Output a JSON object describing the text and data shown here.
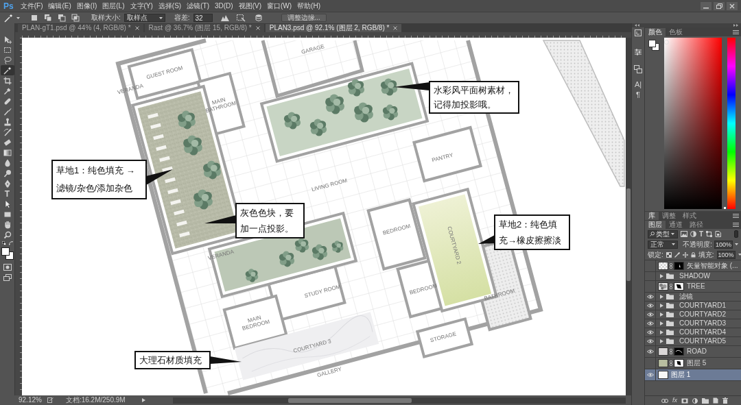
{
  "app": {
    "logo": "Ps"
  },
  "menu": [
    "文件(F)",
    "编辑(E)",
    "图像(I)",
    "图层(L)",
    "文字(Y)",
    "选择(S)",
    "滤镜(T)",
    "3D(D)",
    "视图(V)",
    "窗口(W)",
    "帮助(H)"
  ],
  "options_bar": {
    "sample_size_label": "取样大小:",
    "sample_size": "取样点",
    "tolerance_label": "容差:",
    "tolerance": "32",
    "refine_edge": "调整边缘..."
  },
  "tabs": [
    {
      "label": "PLAN-gT1.psd @ 44% (4, RGB/8) *",
      "selected": false
    },
    {
      "label": "Rast @ 36.7% (图层 15, RGB/8) *",
      "selected": false
    },
    {
      "label": "PLAN3.psd @ 92.1% (图层 2, RGB/8) *",
      "selected": true
    }
  ],
  "tools": [
    {
      "kind": "move",
      "selected": false
    },
    {
      "kind": "marquee",
      "selected": false
    },
    {
      "kind": "lasso",
      "selected": false
    },
    {
      "kind": "magic-wand",
      "selected": true
    },
    {
      "kind": "crop",
      "selected": false
    },
    {
      "kind": "eyedropper",
      "selected": false
    },
    {
      "kind": "healing",
      "selected": false
    },
    {
      "kind": "brush",
      "selected": false
    },
    {
      "kind": "stamp",
      "selected": false
    },
    {
      "kind": "history-brush",
      "selected": false
    },
    {
      "kind": "eraser",
      "selected": false
    },
    {
      "kind": "gradient",
      "selected": false
    },
    {
      "kind": "blur",
      "selected": false
    },
    {
      "kind": "dodge",
      "selected": false
    },
    {
      "kind": "pen",
      "selected": false
    },
    {
      "kind": "type",
      "glyph": "T",
      "selected": false
    },
    {
      "kind": "path-select",
      "selected": false
    },
    {
      "kind": "shape",
      "selected": false
    },
    {
      "kind": "hand",
      "selected": false
    },
    {
      "kind": "zoom",
      "selected": false
    }
  ],
  "canvas": {
    "room_labels": [
      "GARAGE",
      "GUEST ROOM",
      "VERANDA",
      "MAIN BATHROOM",
      "PANTRY",
      "LIVING ROOM",
      "BEDROOM",
      "COURTYARD 2",
      "VERANDA",
      "BEDROOM",
      "STUDY ROOM",
      "BATHROOM",
      "MAIN BEDROOM",
      "COURTYARD 3",
      "STORAGE",
      "GALLERY"
    ],
    "callouts": [
      {
        "lines": [
          "水彩风平面树素材，",
          "记得加投影哦。"
        ]
      },
      {
        "lines": [
          "草地1：纯色填充 →",
          "滤镜/杂色/添加杂色"
        ]
      },
      {
        "lines": [
          "灰色色块，要",
          "加一点投影。"
        ]
      },
      {
        "lines": [
          "草地2：纯色填",
          "充→橡皮擦擦淡"
        ]
      },
      {
        "lines": [
          "大理石材质填充"
        ]
      }
    ]
  },
  "status_bar": {
    "zoom": "92.12%",
    "document": "文档:16.2M/250.9M"
  },
  "dock_icons": [
    {
      "kind": "history"
    },
    {
      "kind": "properties"
    },
    {
      "kind": "comps"
    },
    {
      "kind": "character",
      "glyph": "A|"
    },
    {
      "kind": "paragraph",
      "glyph": "¶"
    }
  ],
  "color_panel": {
    "tabs": [
      {
        "label": "颜色",
        "selected": true
      },
      {
        "label": "色板",
        "selected": false
      }
    ],
    "hue_slider": {
      "level": 0
    }
  },
  "library_panel": {
    "tabs": [
      {
        "label": "库",
        "selected": true
      },
      {
        "label": "调整",
        "selected": false
      },
      {
        "label": "样式",
        "selected": false
      }
    ]
  },
  "layers_panel": {
    "tabs": [
      {
        "label": "图层",
        "selected": true
      },
      {
        "label": "通道",
        "selected": false
      },
      {
        "label": "路径",
        "selected": false
      }
    ],
    "filter": "类型",
    "text_filter_glyph": "T",
    "blend_mode": "正常",
    "opacity_label": "不透明度:",
    "opacity": "100%",
    "lock_label": "锁定:",
    "fill_label": "填充:",
    "fill": "100%",
    "layers": [
      {
        "kind": "layer",
        "name": "矢量智能对象 (...",
        "visible": false,
        "selected": false,
        "mask": true
      },
      {
        "kind": "group",
        "name": "SHADOW",
        "visible": false,
        "selected": false,
        "expanded": false
      },
      {
        "kind": "layer",
        "name": "TREE",
        "visible": false,
        "selected": false,
        "mask": true
      },
      {
        "kind": "group",
        "name": "滤镜",
        "visible": true,
        "selected": false,
        "expanded": false
      },
      {
        "kind": "group",
        "name": "COURTYARD1",
        "visible": true,
        "selected": false,
        "expanded": false
      },
      {
        "kind": "group",
        "name": "COURTYARD2",
        "visible": true,
        "selected": false,
        "expanded": false
      },
      {
        "kind": "group",
        "name": "COURTYARD3",
        "visible": true,
        "selected": false,
        "expanded": false
      },
      {
        "kind": "group",
        "name": "COURTYARD4",
        "visible": true,
        "selected": false,
        "expanded": false
      },
      {
        "kind": "group",
        "name": "COURTYARD5",
        "visible": true,
        "selected": false,
        "expanded": false
      },
      {
        "kind": "layer",
        "name": "ROAD",
        "visible": true,
        "selected": false,
        "mask": true
      },
      {
        "kind": "layer",
        "name": "图层 5",
        "visible": false,
        "selected": false,
        "mask": true
      },
      {
        "kind": "layer",
        "name": "图层 1",
        "visible": true,
        "selected": true,
        "mask": false
      }
    ],
    "fx": "fx"
  }
}
